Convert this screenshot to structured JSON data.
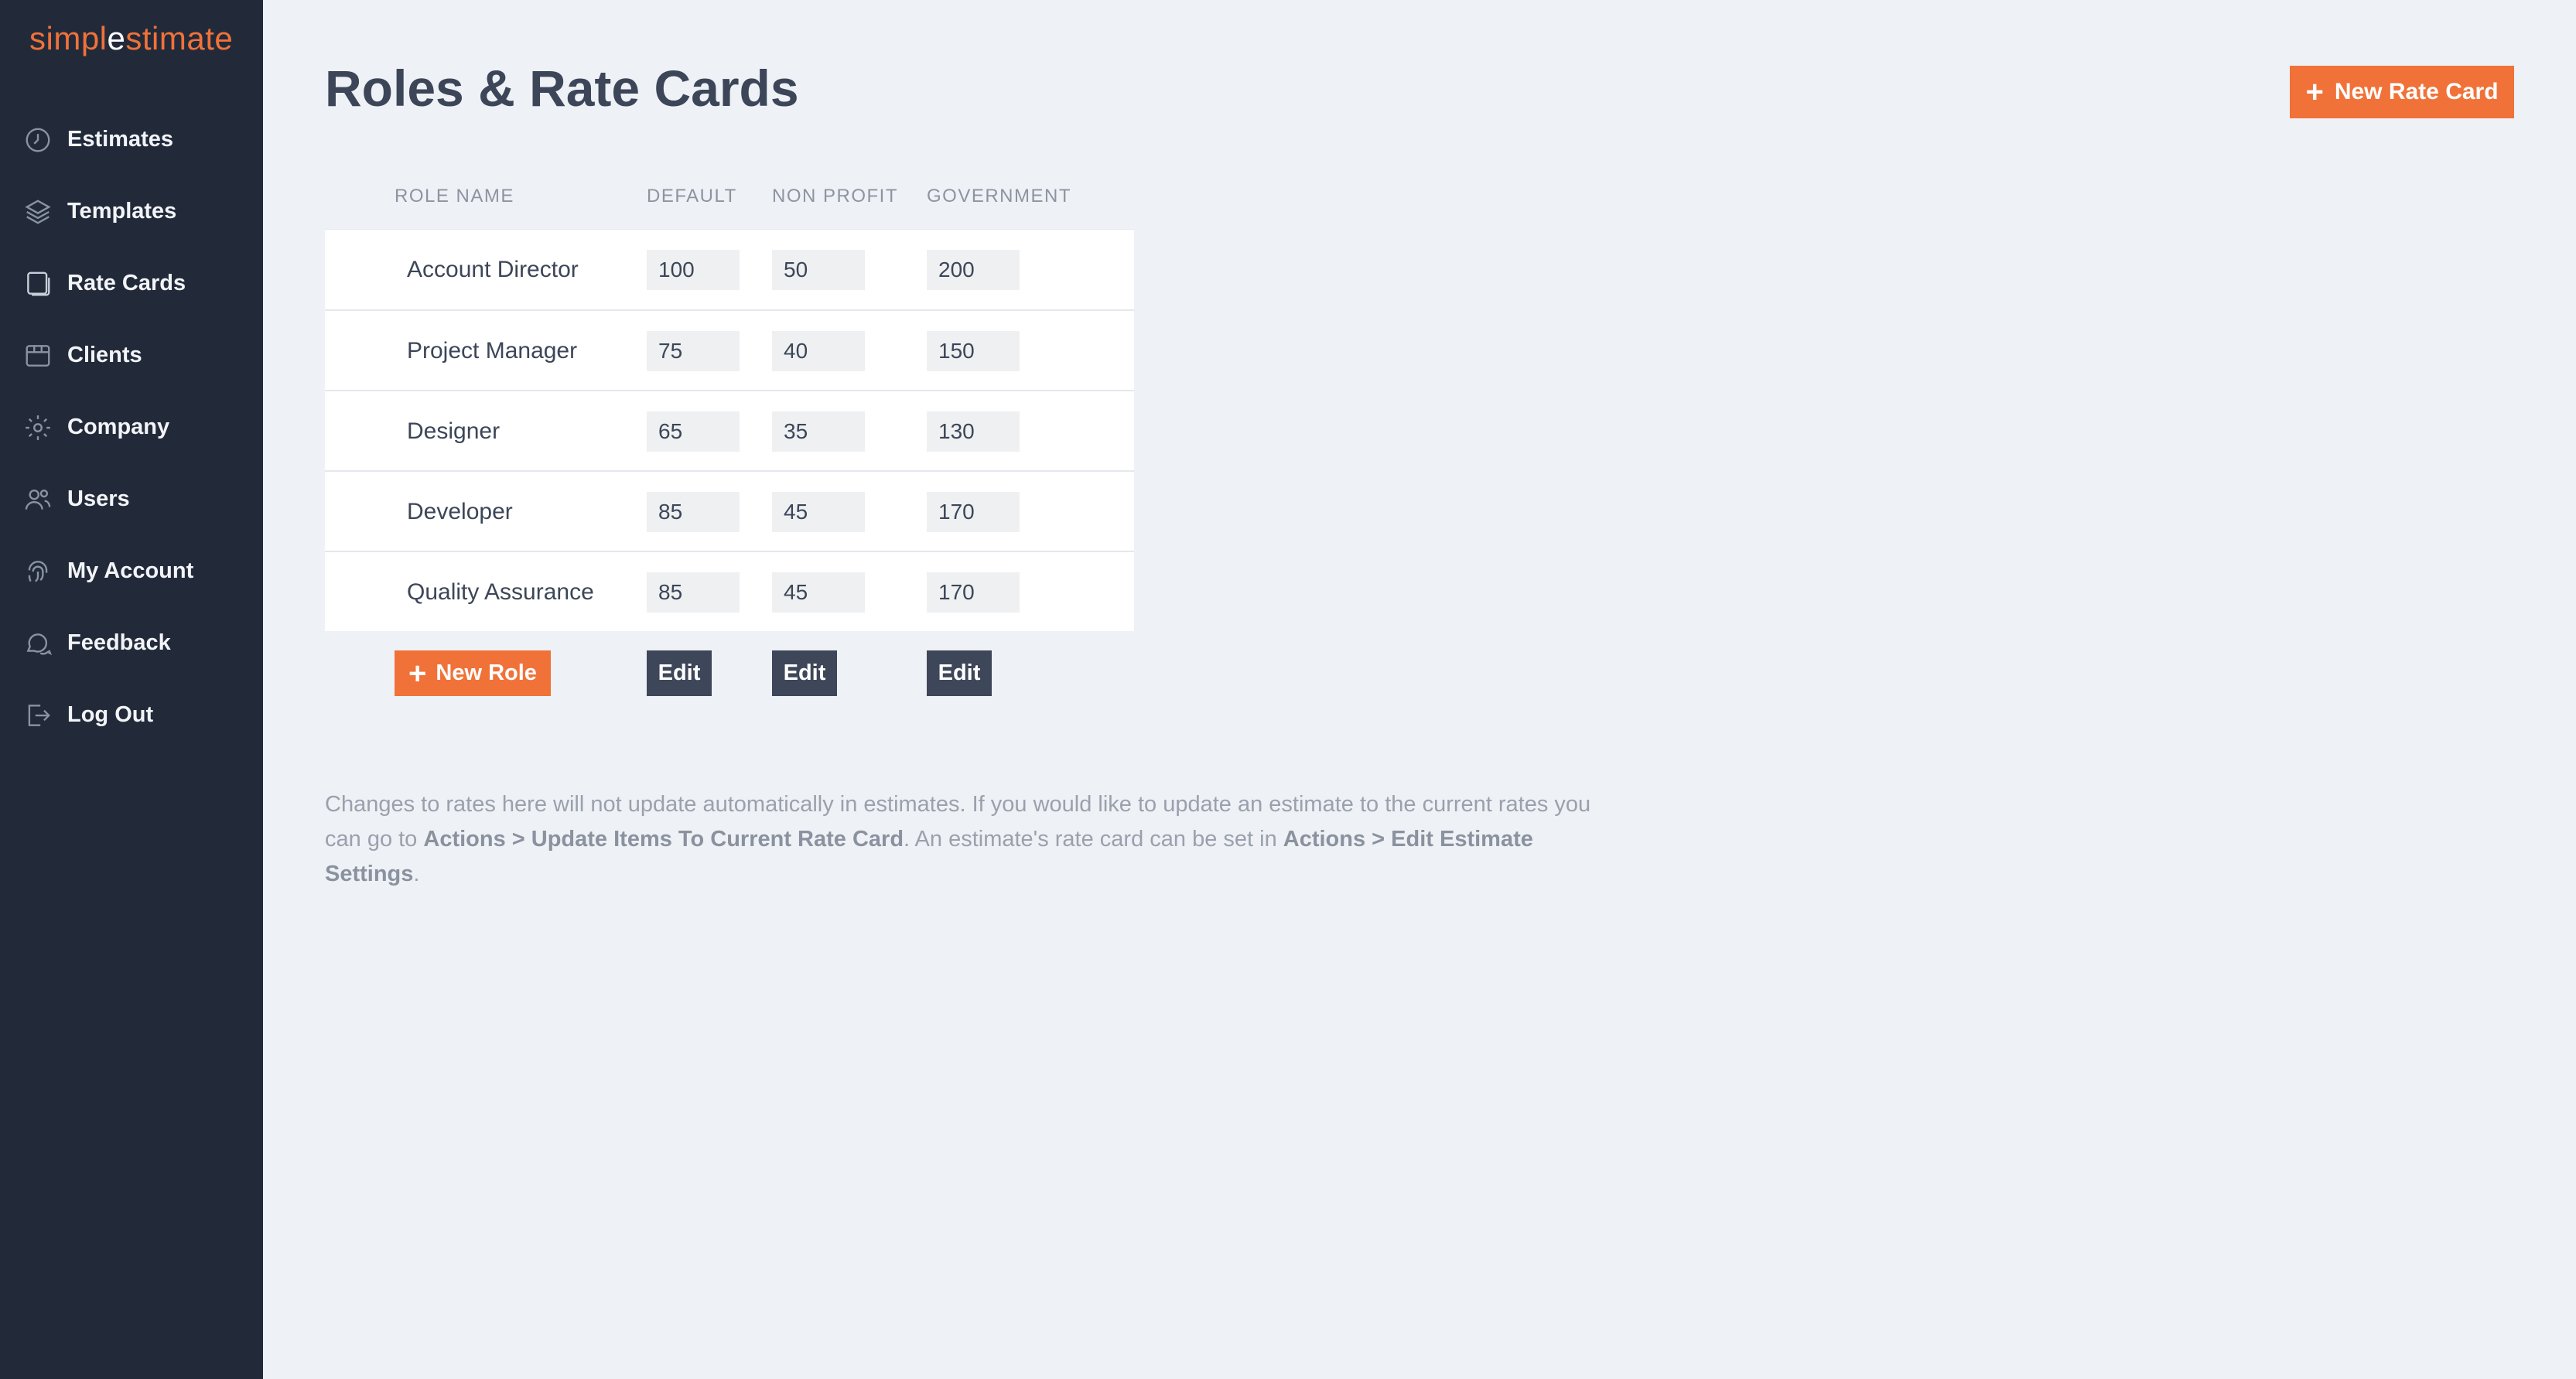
{
  "brand": {
    "prefix": "simpl",
    "accent_letter": "e",
    "suffix": "stimate",
    "color": "#f07239"
  },
  "sidebar": {
    "items": [
      {
        "label": "Estimates",
        "icon": "clock-icon"
      },
      {
        "label": "Templates",
        "icon": "layers-icon"
      },
      {
        "label": "Rate Cards",
        "icon": "cards-icon"
      },
      {
        "label": "Clients",
        "icon": "store-icon"
      },
      {
        "label": "Company",
        "icon": "gear-icon"
      },
      {
        "label": "Users",
        "icon": "users-icon"
      },
      {
        "label": "My Account",
        "icon": "fingerprint-icon"
      },
      {
        "label": "Feedback",
        "icon": "chat-icon"
      },
      {
        "label": "Log Out",
        "icon": "logout-icon"
      }
    ]
  },
  "header": {
    "title": "Roles & Rate Cards",
    "new_rate_card_label": "New Rate Card"
  },
  "table": {
    "columns": [
      "ROLE NAME",
      "DEFAULT",
      "NON PROFIT",
      "GOVERNMENT"
    ],
    "rows": [
      {
        "name": "Account Director",
        "default": "100",
        "non_profit": "50",
        "government": "200"
      },
      {
        "name": "Project Manager",
        "default": "75",
        "non_profit": "40",
        "government": "150"
      },
      {
        "name": "Designer",
        "default": "65",
        "non_profit": "35",
        "government": "130"
      },
      {
        "name": "Developer",
        "default": "85",
        "non_profit": "45",
        "government": "170"
      },
      {
        "name": "Quality Assurance",
        "default": "85",
        "non_profit": "45",
        "government": "170"
      }
    ],
    "new_role_label": "New Role",
    "edit_label": "Edit"
  },
  "note": {
    "part1": "Changes to rates here will not update automatically in estimates. If you would like to update an estimate to the current rates you can go to ",
    "bold1": "Actions > Update Items To Current Rate Card",
    "part2": ". An estimate's rate card can be set in ",
    "bold2": "Actions > Edit Estimate Settings",
    "part3": "."
  },
  "colors": {
    "accent": "#f07239",
    "sidebar_bg": "#222a3a",
    "page_bg": "#eef1f5",
    "dark_button": "#3e4759"
  }
}
